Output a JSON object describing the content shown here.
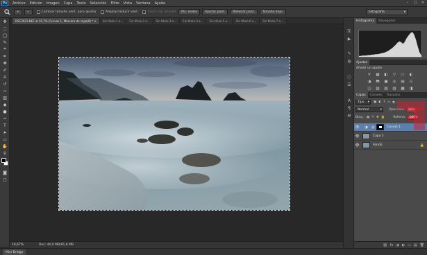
{
  "app": {
    "logo": "Ps",
    "menu": [
      "Archivo",
      "Edición",
      "Imagen",
      "Capa",
      "Texto",
      "Selección",
      "Filtro",
      "Vista",
      "Ventana",
      "Ayuda"
    ],
    "window_controls": [
      "–",
      "□",
      "✕"
    ]
  },
  "options_bar": {
    "tool_icon": "zoom-icon",
    "zoom_in": "+",
    "zoom_out": "−",
    "check_resize": "Cambiar tamaño vent. para ajustar",
    "check_zoom_all": "Ampliar/reducir vent.",
    "check_scrubby": "Zoom con arrastre",
    "btn_actual": "Píx. reales",
    "btn_fit": "Ajustar pant.",
    "btn_fill": "Rellenar pant.",
    "btn_print": "Tamaño impr.",
    "workspace": "Fotografía"
  },
  "tabs": [
    {
      "label": "DSC3623.NEF al 16,7% (Curvas 1, Máscara de capa/8) * ✕",
      "active": true
    },
    {
      "label": "Sin título-1 a...",
      "active": false
    },
    {
      "label": "Sin título-2 a...",
      "active": false
    },
    {
      "label": "Sin título-3 a...",
      "active": false
    },
    {
      "label": "Sin título-4 a...",
      "active": false
    },
    {
      "label": "Sin título-5 a...",
      "active": false
    },
    {
      "label": "Sin título-6 a...",
      "active": false
    },
    {
      "label": "Sin título-7 a...",
      "active": false
    }
  ],
  "status": {
    "zoom": "16,67%",
    "doc": "Doc: 40,9 MB/81,8 MB"
  },
  "minibridge": {
    "tab": "Mini Bridge"
  },
  "panels": {
    "histogram_tabs": [
      "Histograma",
      "Navegador"
    ],
    "adjustments_tab": "Ajustes",
    "adjustments_title": "Añadir un ajuste",
    "adjust_icons": [
      "☀",
      "▦",
      "◧",
      "▽",
      "▭",
      "◐",
      "◑",
      "⬒",
      "▣",
      "◎",
      "▤",
      "☷",
      "◫",
      "▧",
      "▨",
      "▥",
      "▩",
      "◨"
    ],
    "layers_tabs": [
      "Capas",
      "Canales",
      "Trazados"
    ],
    "kind": "Tipo",
    "blend_mode": "Normal",
    "opacity_label": "Opacidad:",
    "opacity_value": "50%",
    "lock_label": "Bloq.:",
    "fill_label": "Relleno:",
    "fill_value": "100%",
    "layers": [
      {
        "name": "Curvas 1",
        "selected": true
      },
      {
        "name": "Capa 1",
        "selected": false
      },
      {
        "name": "Fondo",
        "selected": false
      }
    ],
    "footer_icons": [
      "⛓",
      "fx",
      "◑",
      "◐",
      "▭",
      "▤",
      "🗑"
    ]
  },
  "histogram_shape": [
    2,
    2,
    3,
    3,
    3,
    4,
    4,
    5,
    5,
    6,
    6,
    7,
    8,
    9,
    10,
    12,
    14,
    17,
    20,
    24,
    28,
    33,
    36,
    34,
    30,
    36,
    44,
    50,
    55,
    58,
    52,
    40,
    24,
    10,
    3
  ]
}
